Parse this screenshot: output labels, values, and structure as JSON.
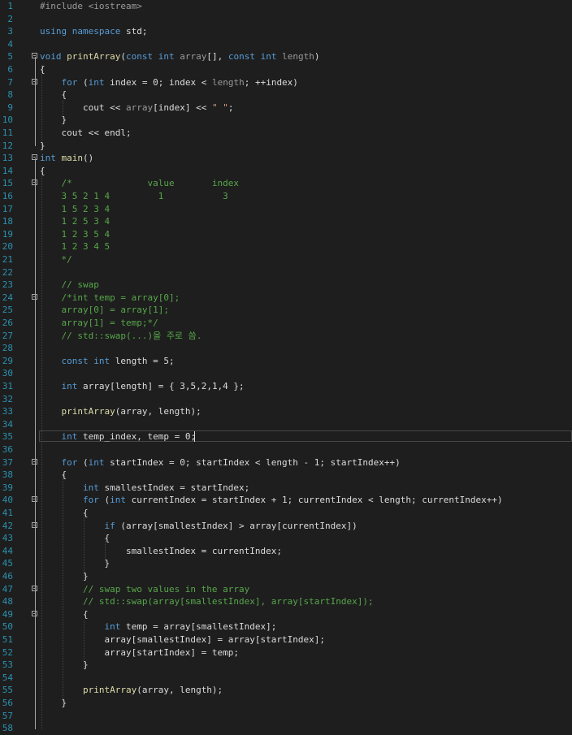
{
  "editor": {
    "language": "C++",
    "theme": "dark",
    "cursor_line": 35,
    "lines": [
      {
        "n": "1",
        "tokens": [
          [
            "pp",
            "#include <iostream>"
          ]
        ]
      },
      {
        "n": "2",
        "tokens": []
      },
      {
        "n": "3",
        "tokens": [
          [
            "kw",
            "using"
          ],
          [
            "var",
            " "
          ],
          [
            "kw",
            "namespace"
          ],
          [
            "var",
            " std;"
          ]
        ]
      },
      {
        "n": "4",
        "tokens": []
      },
      {
        "n": "5",
        "fold": true,
        "tokens": [
          [
            "ty",
            "void"
          ],
          [
            "var",
            " "
          ],
          [
            "fn",
            "printArray"
          ],
          [
            "var",
            "("
          ],
          [
            "kw",
            "const"
          ],
          [
            "var",
            " "
          ],
          [
            "ty",
            "int"
          ],
          [
            "var",
            " "
          ],
          [
            "prm",
            "array"
          ],
          [
            "var",
            "[], "
          ],
          [
            "kw",
            "const"
          ],
          [
            "var",
            " "
          ],
          [
            "ty",
            "int"
          ],
          [
            "var",
            " "
          ],
          [
            "prm",
            "length"
          ],
          [
            "var",
            ")"
          ]
        ]
      },
      {
        "n": "6",
        "tokens": [
          [
            "var",
            "{"
          ]
        ]
      },
      {
        "n": "7",
        "fold": true,
        "tokens": [
          [
            "var",
            "    "
          ],
          [
            "kw",
            "for"
          ],
          [
            "var",
            " ("
          ],
          [
            "ty",
            "int"
          ],
          [
            "var",
            " index = 0; index < "
          ],
          [
            "prm",
            "length"
          ],
          [
            "var",
            "; ++index)"
          ]
        ]
      },
      {
        "n": "8",
        "tokens": [
          [
            "var",
            "    {"
          ]
        ]
      },
      {
        "n": "9",
        "tokens": [
          [
            "var",
            "        cout << "
          ],
          [
            "prm",
            "array"
          ],
          [
            "var",
            "[index] << "
          ],
          [
            "str",
            "\" \""
          ],
          [
            "var",
            ";"
          ]
        ]
      },
      {
        "n": "10",
        "tokens": [
          [
            "var",
            "    }"
          ]
        ]
      },
      {
        "n": "11",
        "tokens": [
          [
            "var",
            "    cout << endl;"
          ]
        ]
      },
      {
        "n": "12",
        "tokens": [
          [
            "var",
            "}"
          ]
        ]
      },
      {
        "n": "13",
        "fold": true,
        "tokens": [
          [
            "ty",
            "int"
          ],
          [
            "var",
            " "
          ],
          [
            "fn",
            "main"
          ],
          [
            "var",
            "()"
          ]
        ]
      },
      {
        "n": "14",
        "tokens": [
          [
            "var",
            "{"
          ]
        ]
      },
      {
        "n": "15",
        "fold": true,
        "tokens": [
          [
            "cm",
            "    /*              value       index"
          ]
        ]
      },
      {
        "n": "16",
        "tokens": [
          [
            "cm",
            "    3 5 2 1 4         1           3"
          ]
        ]
      },
      {
        "n": "17",
        "tokens": [
          [
            "cm",
            "    1 5 2 3 4"
          ]
        ]
      },
      {
        "n": "18",
        "tokens": [
          [
            "cm",
            "    1 2 5 3 4"
          ]
        ]
      },
      {
        "n": "19",
        "tokens": [
          [
            "cm",
            "    1 2 3 5 4"
          ]
        ]
      },
      {
        "n": "20",
        "tokens": [
          [
            "cm",
            "    1 2 3 4 5"
          ]
        ]
      },
      {
        "n": "21",
        "tokens": [
          [
            "cm",
            "    */"
          ]
        ]
      },
      {
        "n": "22",
        "tokens": []
      },
      {
        "n": "23",
        "tokens": [
          [
            "cm",
            "    // swap"
          ]
        ]
      },
      {
        "n": "24",
        "fold": true,
        "tokens": [
          [
            "cm",
            "    /*int temp = array[0];"
          ]
        ]
      },
      {
        "n": "25",
        "tokens": [
          [
            "cm",
            "    array[0] = array[1];"
          ]
        ]
      },
      {
        "n": "26",
        "tokens": [
          [
            "cm",
            "    array[1] = temp;*/"
          ]
        ]
      },
      {
        "n": "27",
        "tokens": [
          [
            "cm",
            "    // std::swap(...)을 주로 씀."
          ]
        ]
      },
      {
        "n": "28",
        "tokens": []
      },
      {
        "n": "29",
        "tokens": [
          [
            "var",
            "    "
          ],
          [
            "kw",
            "const"
          ],
          [
            "var",
            " "
          ],
          [
            "ty",
            "int"
          ],
          [
            "var",
            " length = 5;"
          ]
        ]
      },
      {
        "n": "30",
        "tokens": []
      },
      {
        "n": "31",
        "tokens": [
          [
            "var",
            "    "
          ],
          [
            "ty",
            "int"
          ],
          [
            "var",
            " array[length] = { 3,5,2,1,4 };"
          ]
        ]
      },
      {
        "n": "32",
        "tokens": []
      },
      {
        "n": "33",
        "tokens": [
          [
            "var",
            "    "
          ],
          [
            "fn",
            "printArray"
          ],
          [
            "var",
            "(array, length);"
          ]
        ]
      },
      {
        "n": "34",
        "tokens": []
      },
      {
        "n": "35",
        "tokens": [
          [
            "var",
            "    "
          ],
          [
            "ty",
            "int"
          ],
          [
            "var",
            " temp_index, temp = 0;"
          ]
        ]
      },
      {
        "n": "36",
        "tokens": []
      },
      {
        "n": "37",
        "fold": true,
        "tokens": [
          [
            "var",
            "    "
          ],
          [
            "kw",
            "for"
          ],
          [
            "var",
            " ("
          ],
          [
            "ty",
            "int"
          ],
          [
            "var",
            " startIndex = 0; startIndex < length - 1; startIndex++)"
          ]
        ]
      },
      {
        "n": "38",
        "tokens": [
          [
            "var",
            "    {"
          ]
        ]
      },
      {
        "n": "39",
        "tokens": [
          [
            "var",
            "        "
          ],
          [
            "ty",
            "int"
          ],
          [
            "var",
            " smallestIndex = startIndex;"
          ]
        ]
      },
      {
        "n": "40",
        "fold": true,
        "tokens": [
          [
            "var",
            "        "
          ],
          [
            "kw",
            "for"
          ],
          [
            "var",
            " ("
          ],
          [
            "ty",
            "int"
          ],
          [
            "var",
            " currentIndex = startIndex + 1; currentIndex < length; currentIndex++)"
          ]
        ]
      },
      {
        "n": "41",
        "tokens": [
          [
            "var",
            "        {"
          ]
        ]
      },
      {
        "n": "42",
        "fold": true,
        "tokens": [
          [
            "var",
            "            "
          ],
          [
            "kw",
            "if"
          ],
          [
            "var",
            " (array[smallestIndex] > array[currentIndex])"
          ]
        ]
      },
      {
        "n": "43",
        "tokens": [
          [
            "var",
            "            {"
          ]
        ]
      },
      {
        "n": "44",
        "tokens": [
          [
            "var",
            "                smallestIndex = currentIndex;"
          ]
        ]
      },
      {
        "n": "45",
        "tokens": [
          [
            "var",
            "            }"
          ]
        ]
      },
      {
        "n": "46",
        "tokens": [
          [
            "var",
            "        }"
          ]
        ]
      },
      {
        "n": "47",
        "fold": true,
        "tokens": [
          [
            "cm",
            "        // swap two values in the array"
          ]
        ]
      },
      {
        "n": "48",
        "tokens": [
          [
            "cm",
            "        // std::swap(array[smallestIndex], array[startIndex]);"
          ]
        ]
      },
      {
        "n": "49",
        "fold": true,
        "tokens": [
          [
            "var",
            "        {"
          ]
        ]
      },
      {
        "n": "50",
        "tokens": [
          [
            "var",
            "            "
          ],
          [
            "ty",
            "int"
          ],
          [
            "var",
            " temp = array[smallestIndex];"
          ]
        ]
      },
      {
        "n": "51",
        "tokens": [
          [
            "var",
            "            array[smallestIndex] = array[startIndex];"
          ]
        ]
      },
      {
        "n": "52",
        "tokens": [
          [
            "var",
            "            array[startIndex] = temp;"
          ]
        ]
      },
      {
        "n": "53",
        "tokens": [
          [
            "var",
            "        }"
          ]
        ]
      },
      {
        "n": "54",
        "tokens": []
      },
      {
        "n": "55",
        "tokens": [
          [
            "var",
            "        "
          ],
          [
            "fn",
            "printArray"
          ],
          [
            "var",
            "(array, length);"
          ]
        ]
      },
      {
        "n": "56",
        "tokens": [
          [
            "var",
            "    }"
          ]
        ]
      },
      {
        "n": "57",
        "tokens": []
      },
      {
        "n": "58",
        "tokens": []
      }
    ]
  }
}
